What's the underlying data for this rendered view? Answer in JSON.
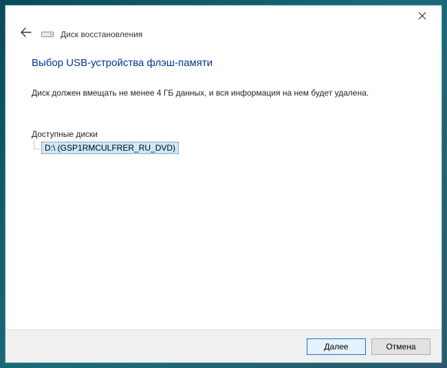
{
  "window": {
    "header_title": "Диск восстановления"
  },
  "content": {
    "main_title": "Выбор USB-устройства флэш-памяти",
    "description": "Диск должен вмещать не менее 4 ГБ данных, и вся информация на нем будет удалена.",
    "list_label": "Доступные диски",
    "drives": [
      {
        "label": "D:\\ (GSP1RMCULFRER_RU_DVD)"
      }
    ]
  },
  "footer": {
    "next_label": "Далее",
    "cancel_label": "Отмена"
  }
}
